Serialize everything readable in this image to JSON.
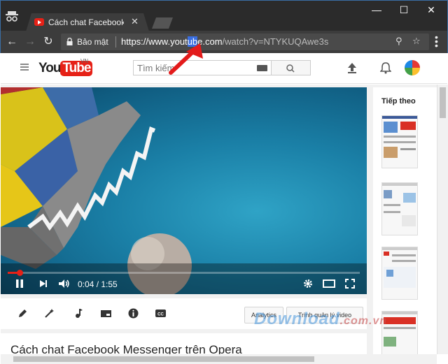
{
  "browser": {
    "tab_title": "Cách chat Facebook M",
    "security_label": "Bảo mật",
    "url_prefix": "https://",
    "url_host_a": "www.yout",
    "url_host_sel": "ub",
    "url_host_b": "e.com",
    "url_path": "/watch?v=NTYKUQAwe3s",
    "icons": {
      "incognito": "incognito-icon",
      "back": "back-arrow-icon",
      "forward": "forward-arrow-icon",
      "reload": "reload-icon",
      "lock": "lock-icon",
      "zoom": "zoom-icon",
      "bookmark": "star-icon",
      "menu": "menu-dots-icon"
    }
  },
  "youtube": {
    "logo_you": "You",
    "logo_tube": "Tube",
    "logo_region": "VN",
    "search_placeholder": "Tìm kiếm",
    "up_next_label": "Tiếp theo"
  },
  "player": {
    "current_time": "0:04 / 1:55",
    "progress_fraction": 0.034
  },
  "actions": {
    "analytics_label": "Analytics",
    "video_manager_label": "Trình quản lý video"
  },
  "video": {
    "title": "Cách chat Facebook Messenger trên Opera"
  },
  "watermark": {
    "text": "Download",
    "suffix": ".com.vn"
  },
  "colors": {
    "brand_red": "#e62117",
    "annotation_arrow": "#e31b1b",
    "selection_blue": "#3a6ee0"
  }
}
